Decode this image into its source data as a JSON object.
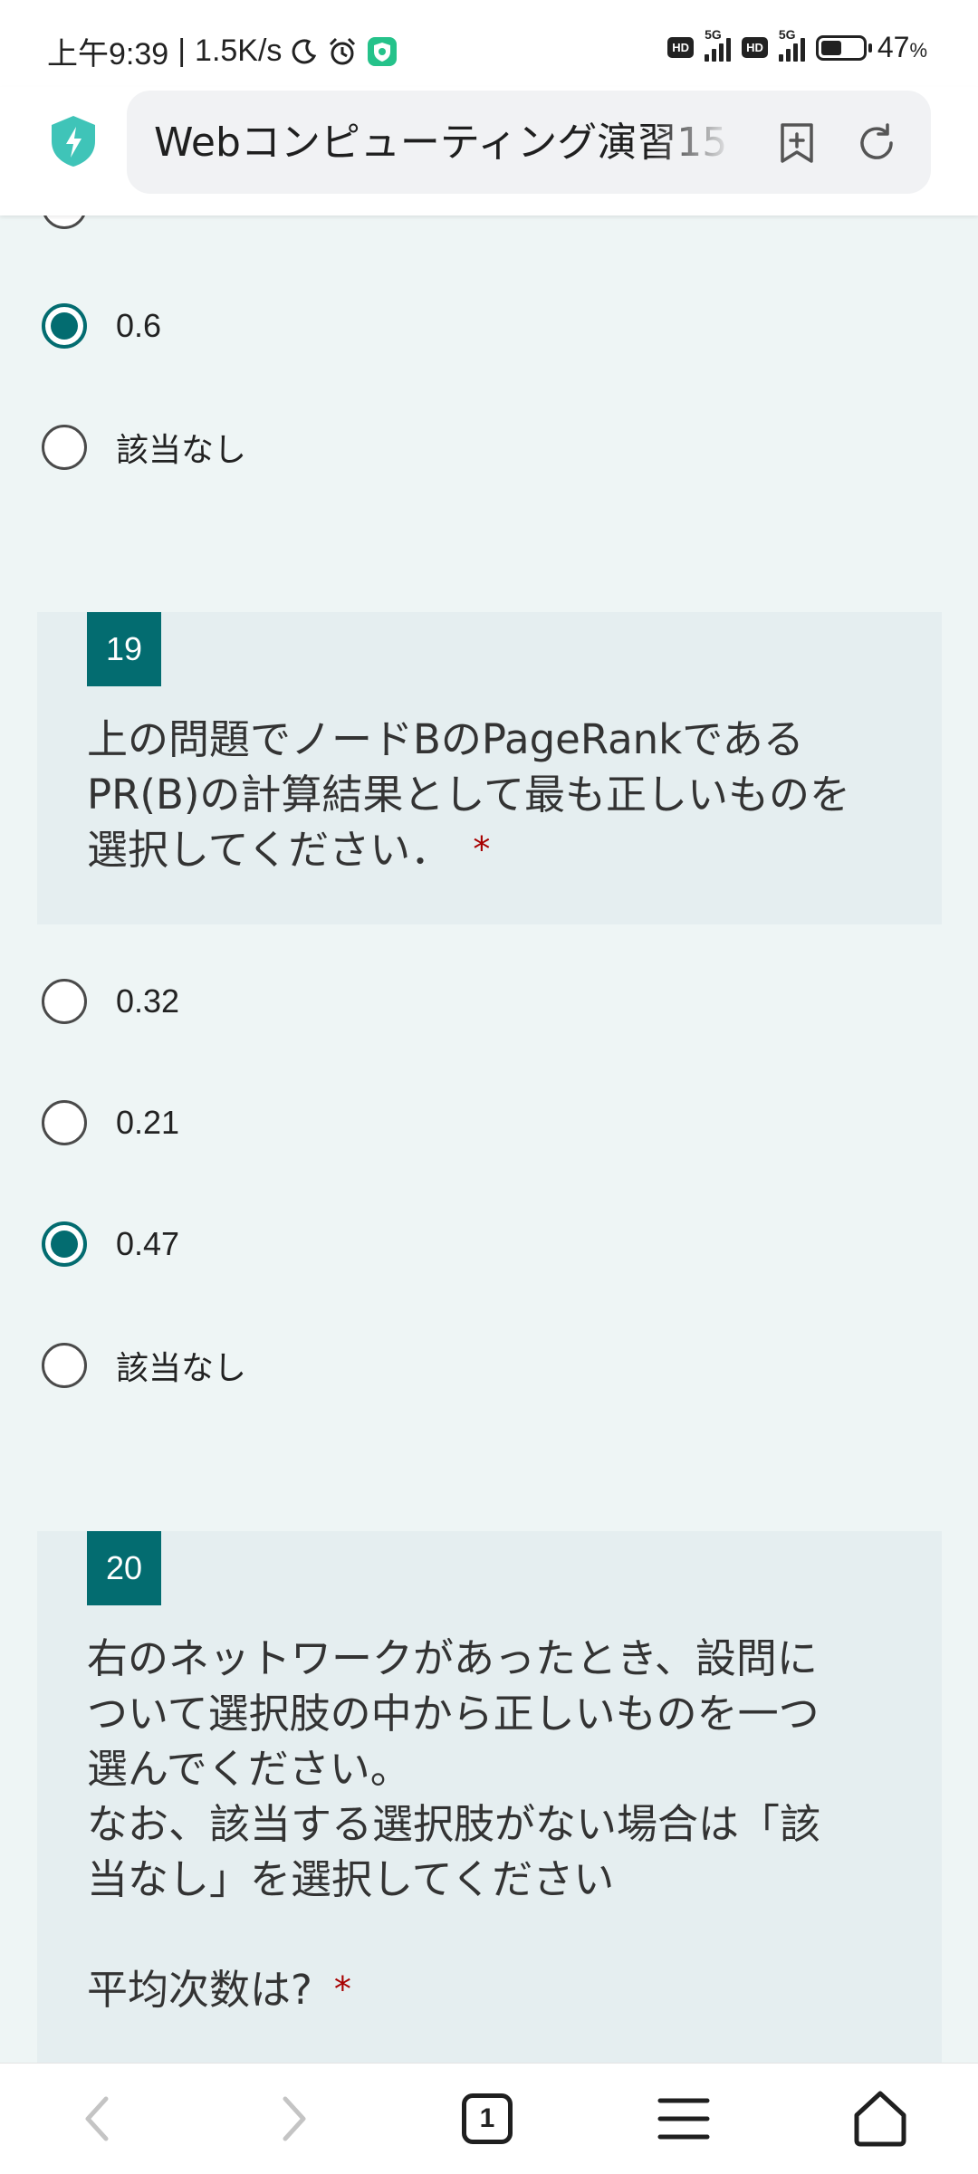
{
  "status_bar": {
    "time": "上午9:39",
    "net_speed": "1.5K/s",
    "battery_percent": "47",
    "battery_unit": "%",
    "network_type": "5G",
    "hd_label": "HD"
  },
  "browser": {
    "url_text": "Webコンピューティング演習15"
  },
  "prev_question_options": [
    {
      "label": "0.6",
      "checked": true
    },
    {
      "label": "該当なし",
      "checked": false
    }
  ],
  "question19": {
    "number": "19",
    "text": "上の問題でノードBのPageRankである\nPR(B)の計算結果として最も正しいものを\n選択してください．",
    "required_mark": "*",
    "options": [
      {
        "label": "0.32",
        "checked": false
      },
      {
        "label": "0.21",
        "checked": false
      },
      {
        "label": "0.47",
        "checked": true
      },
      {
        "label": "該当なし",
        "checked": false
      }
    ]
  },
  "question20": {
    "number": "20",
    "text": "右のネットワークがあったとき、設問に\nついて選択肢の中から正しいものを一つ\n選んでください。\nなお、該当する選択肢がない場合は「該\n当なし」を選択してください\n\n平均次数は?",
    "required_mark": "*"
  },
  "bottom_nav": {
    "tab_count": "1"
  },
  "colors": {
    "accent": "#036c70",
    "page_bg": "#eef5f5",
    "card_bg": "#e5eef0",
    "required": "#a80000"
  }
}
